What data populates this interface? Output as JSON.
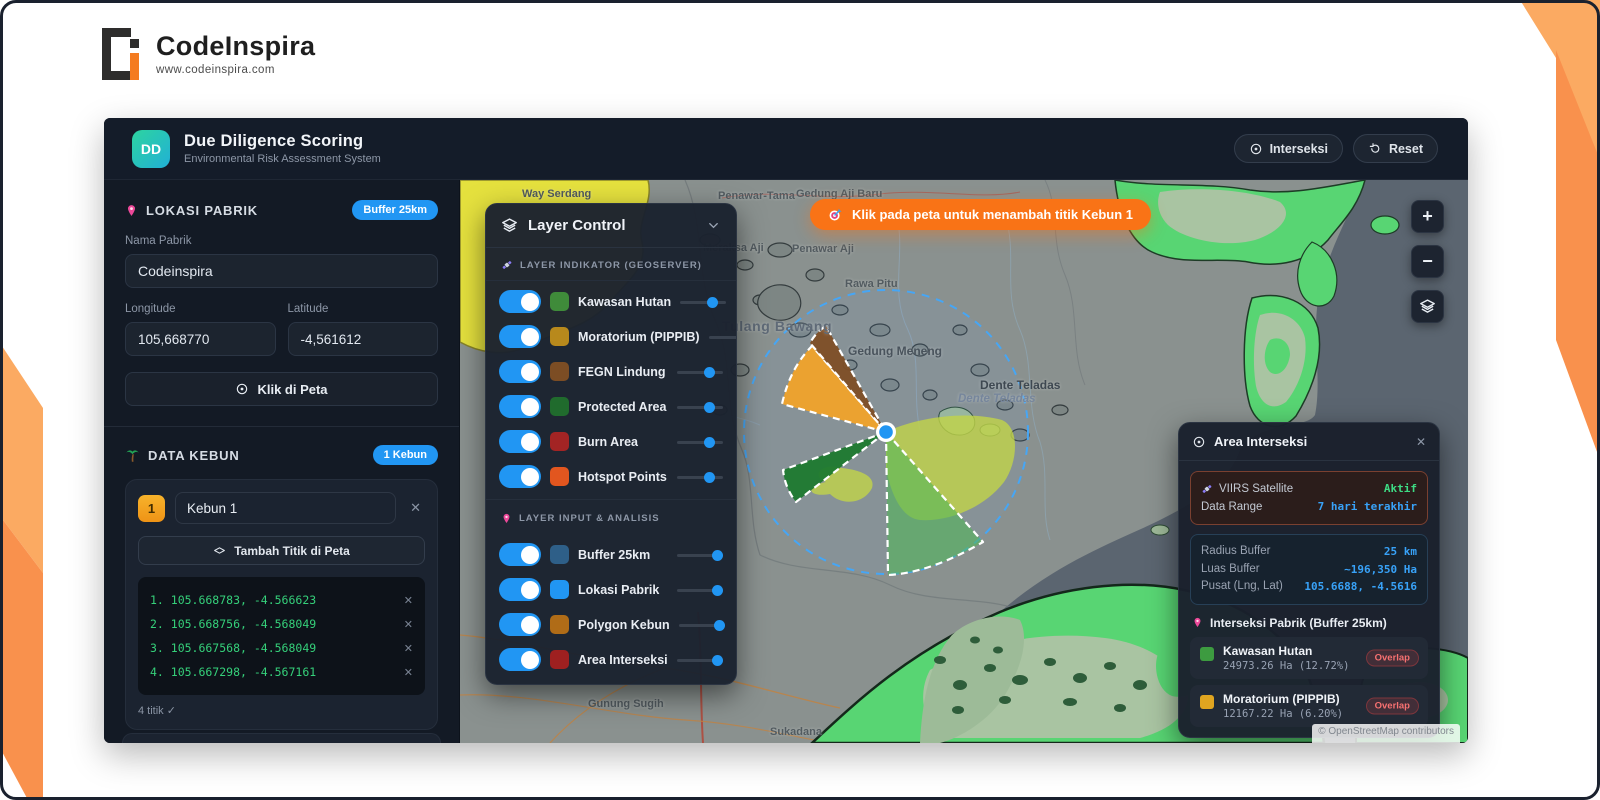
{
  "brand": {
    "name": "CodeInspira",
    "url": "www.codeinspira.com"
  },
  "header": {
    "logo_text": "DD",
    "title": "Due Diligence Scoring",
    "subtitle": "Environmental Risk Assessment System",
    "interseksi_button": "Interseksi",
    "reset_button": "Reset"
  },
  "sidebar": {
    "lokasi": {
      "title": "LOKASI PABRIK",
      "badge": "Buffer 25km",
      "nama_label": "Nama Pabrik",
      "nama_value": "Codeinspira",
      "longitude_label": "Longitude",
      "longitude_value": "105,668770",
      "latitude_label": "Latitude",
      "latitude_value": "-4,561612",
      "klik_button": "Klik di Peta"
    },
    "kebun": {
      "title": "DATA KEBUN",
      "badge": "1 Kebun",
      "item_number": "1",
      "item_name": "Kebun 1",
      "tambah_button": "Tambah Titik di Peta",
      "points": [
        "1. 105.668783, -4.566623",
        "2. 105.668756, -4.568049",
        "3. 105.667568, -4.568049",
        "4. 105.667298, -4.567161"
      ],
      "count_label": "4 titik ✓"
    }
  },
  "layer_control": {
    "title": "Layer Control",
    "indikator_title": "LAYER INDIKATOR (GEOSERVER)",
    "indikator_layers": [
      {
        "label": "Kawasan Hutan",
        "color": "#3f8b3a"
      },
      {
        "label": "Moratorium (PIPPIB)",
        "color": "#b8891c"
      },
      {
        "label": "FEGN Lindung",
        "color": "#7c4d24"
      },
      {
        "label": "Protected Area",
        "color": "#206b2d"
      },
      {
        "label": "Burn Area",
        "color": "#a32424"
      },
      {
        "label": "Hotspot Points",
        "color": "#e2561f"
      }
    ],
    "input_title": "LAYER INPUT & ANALISIS",
    "input_layers": [
      {
        "label": "Buffer 25km",
        "color": "#2e5f88"
      },
      {
        "label": "Lokasi Pabrik",
        "color": "#2196f3"
      },
      {
        "label": "Polygon Kebun",
        "color": "#b06c17"
      },
      {
        "label": "Area Interseksi",
        "color": "#9e2020"
      }
    ]
  },
  "toast": {
    "text": "Klik pada peta untuk menambah titik Kebun 1"
  },
  "map": {
    "zoom_in": "+",
    "zoom_out": "−",
    "attribution": "© OpenStreetMap contributors",
    "labels": {
      "way_serdang": "Way Serdang",
      "penawar_tama": "Penawar-Tama",
      "gedung_aji_baru": "Gedung Aji Baru",
      "meraksa_aji": "Meraksa Aji",
      "penawar_aji": "Penawar Aji",
      "rawa_pitu": "Rawa Pitu",
      "tulang_bawang": "Tulang Bawang",
      "gedung_meneng": "Gedung Meneng",
      "dente_teladas": "Dente Teladas",
      "dente_teladas_region": "Dente Teladas",
      "gunung_sugih": "Gunung Sugih",
      "sukadana": "Sukadana"
    }
  },
  "interseksi_panel": {
    "title": "Area Interseksi",
    "viirs": {
      "label": "VIIRS Satellite",
      "status": "Aktif",
      "range_label": "Data Range",
      "range_value": "7 hari terakhir"
    },
    "buffer": {
      "radius_label": "Radius Buffer",
      "radius_value": "25 km",
      "luas_label": "Luas Buffer",
      "luas_value": "~196,350 Ha",
      "pusat_label": "Pusat (Lng, Lat)",
      "pusat_value": "105.6688, -4.5616"
    },
    "section_title": "Interseksi Pabrik (Buffer 25km)",
    "results": [
      {
        "name": "Kawasan Hutan",
        "value": "24973.26 Ha (12.72%)",
        "badge": "Overlap",
        "color": "#3d9b40"
      },
      {
        "name": "Moratorium (PIPPIB)",
        "value": "12167.22 Ha (6.20%)",
        "badge": "Overlap",
        "color": "#e0a520"
      }
    ]
  },
  "ui": {
    "close_icon": "✕"
  }
}
